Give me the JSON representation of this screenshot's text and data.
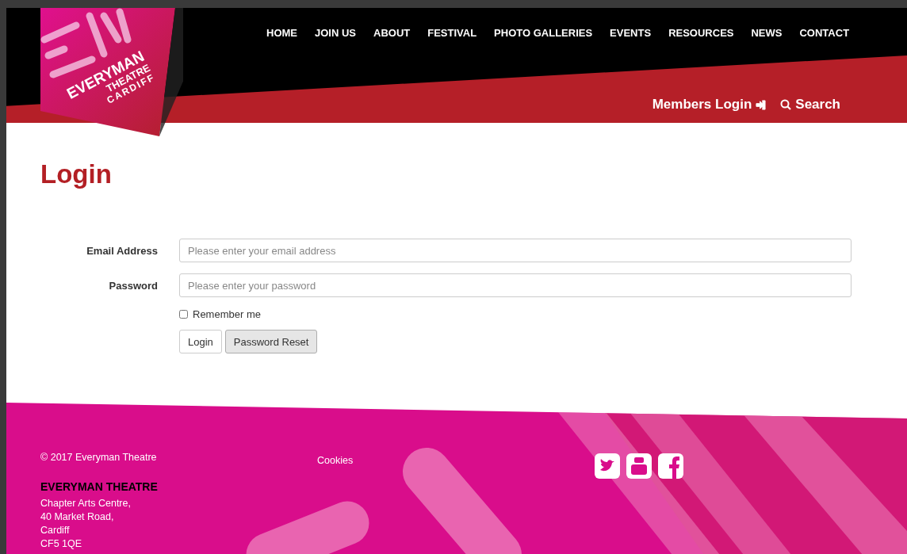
{
  "logo": {
    "lines": [
      "EVERYMAN",
      "THEATRE",
      "CARDIFF"
    ]
  },
  "nav": [
    {
      "label": "HOME"
    },
    {
      "label": "JOIN US"
    },
    {
      "label": "ABOUT"
    },
    {
      "label": "FESTIVAL"
    },
    {
      "label": "PHOTO GALLERIES"
    },
    {
      "label": "EVENTS"
    },
    {
      "label": "RESOURCES"
    },
    {
      "label": "NEWS"
    },
    {
      "label": "CONTACT"
    }
  ],
  "utility": {
    "login": "Members Login",
    "search": "Search"
  },
  "page_title": "Login",
  "form": {
    "fields": [
      {
        "label": "Email Address",
        "placeholder": "Please enter your email address"
      },
      {
        "label": "Password",
        "placeholder": "Please enter your password"
      }
    ],
    "remember": {
      "label": "Remember me",
      "checked": false
    },
    "buttons": [
      {
        "label": "Login",
        "kind": "primary"
      },
      {
        "label": "Password Reset",
        "kind": "secondary"
      }
    ]
  },
  "footer": {
    "copyright": "© 2017 Everyman Theatre",
    "cookies": "Cookies",
    "org": "EVERYMAN THEATRE",
    "address": [
      "Chapter Arts Centre,",
      "40 Market Road,",
      "Cardiff",
      "CF5 1QE"
    ]
  }
}
